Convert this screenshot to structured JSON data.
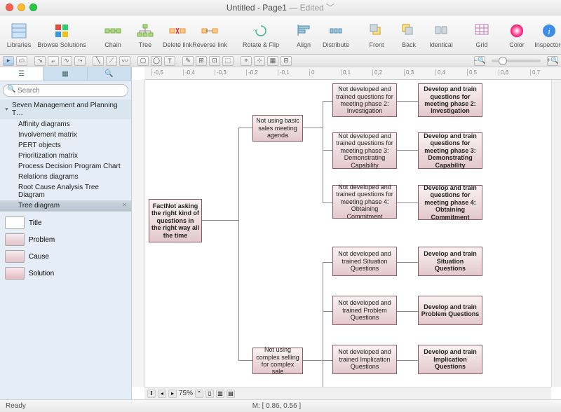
{
  "window": {
    "title_main": "Untitled - Page1",
    "title_state": "Edited",
    "title_sep": " — "
  },
  "toolbar": {
    "libraries": "Libraries",
    "browse": "Browse Solutions",
    "chain": "Chain",
    "tree": "Tree",
    "dellink": "Delete link",
    "revlink": "Reverse link",
    "rotate": "Rotate & Flip",
    "align": "Align",
    "distribute": "Distribute",
    "front": "Front",
    "back": "Back",
    "identical": "Identical",
    "grid": "Grid",
    "color": "Color",
    "inspectors": "Inspectors"
  },
  "search": {
    "placeholder": "Search"
  },
  "library": {
    "header": "Seven Management and Planning T…",
    "items": [
      "Affinity diagrams",
      "Involvement matrix",
      "PERT objects",
      "Prioritization matrix",
      "Process Decision Program Chart",
      "Relations diagrams",
      "Root Cause Analysis Tree Diagram",
      "Tree diagram"
    ],
    "selected_index": 7
  },
  "shapes": {
    "title": "Title",
    "problem": "Problem",
    "cause": "Cause",
    "solution": "Solution"
  },
  "nodes": {
    "root": "FactNot asking the right kind of questions in the right way all the time",
    "b1": "Not using basic sales meeting agenda",
    "b2": "Not using complex selling for complex sale",
    "c1": "Not developed and trained questions for meeting phase 2: Investigation",
    "c2": "Not developed and trained questions for meeting phase 3: Demonstrating Capability",
    "c3": "Not developed and trained questions for meeting phase 4: Obtaining Commitment",
    "c4": "Not developed and trained Situation Questions",
    "c5": "Not developed and trained Problem Questions",
    "c6": "Not developed and trained Implication Questions",
    "d1": "Develop and train questions for meeting phase 2: Investigation",
    "d2": "Develop and train questions for meeting phase 3: Demonstrating Capability",
    "d3": "Develop and train questions for meeting phase 4: Obtaining Commitment",
    "d4": "Develop and train Situation Questions",
    "d5": "Develop and train Problem Questions",
    "d6": "Develop and train Implication Questions"
  },
  "status": {
    "ready": "Ready",
    "mouse": "M: [ 0.86, 0.56 ]"
  },
  "zoom": {
    "value": "75%"
  },
  "ruler_ticks": [
    "-0,5",
    "-0,4",
    "-0,3",
    "-0,2",
    "-0,1",
    "0",
    "0,1",
    "0,2",
    "0,3",
    "0,4",
    "0,5",
    "0,6",
    "0,7"
  ]
}
